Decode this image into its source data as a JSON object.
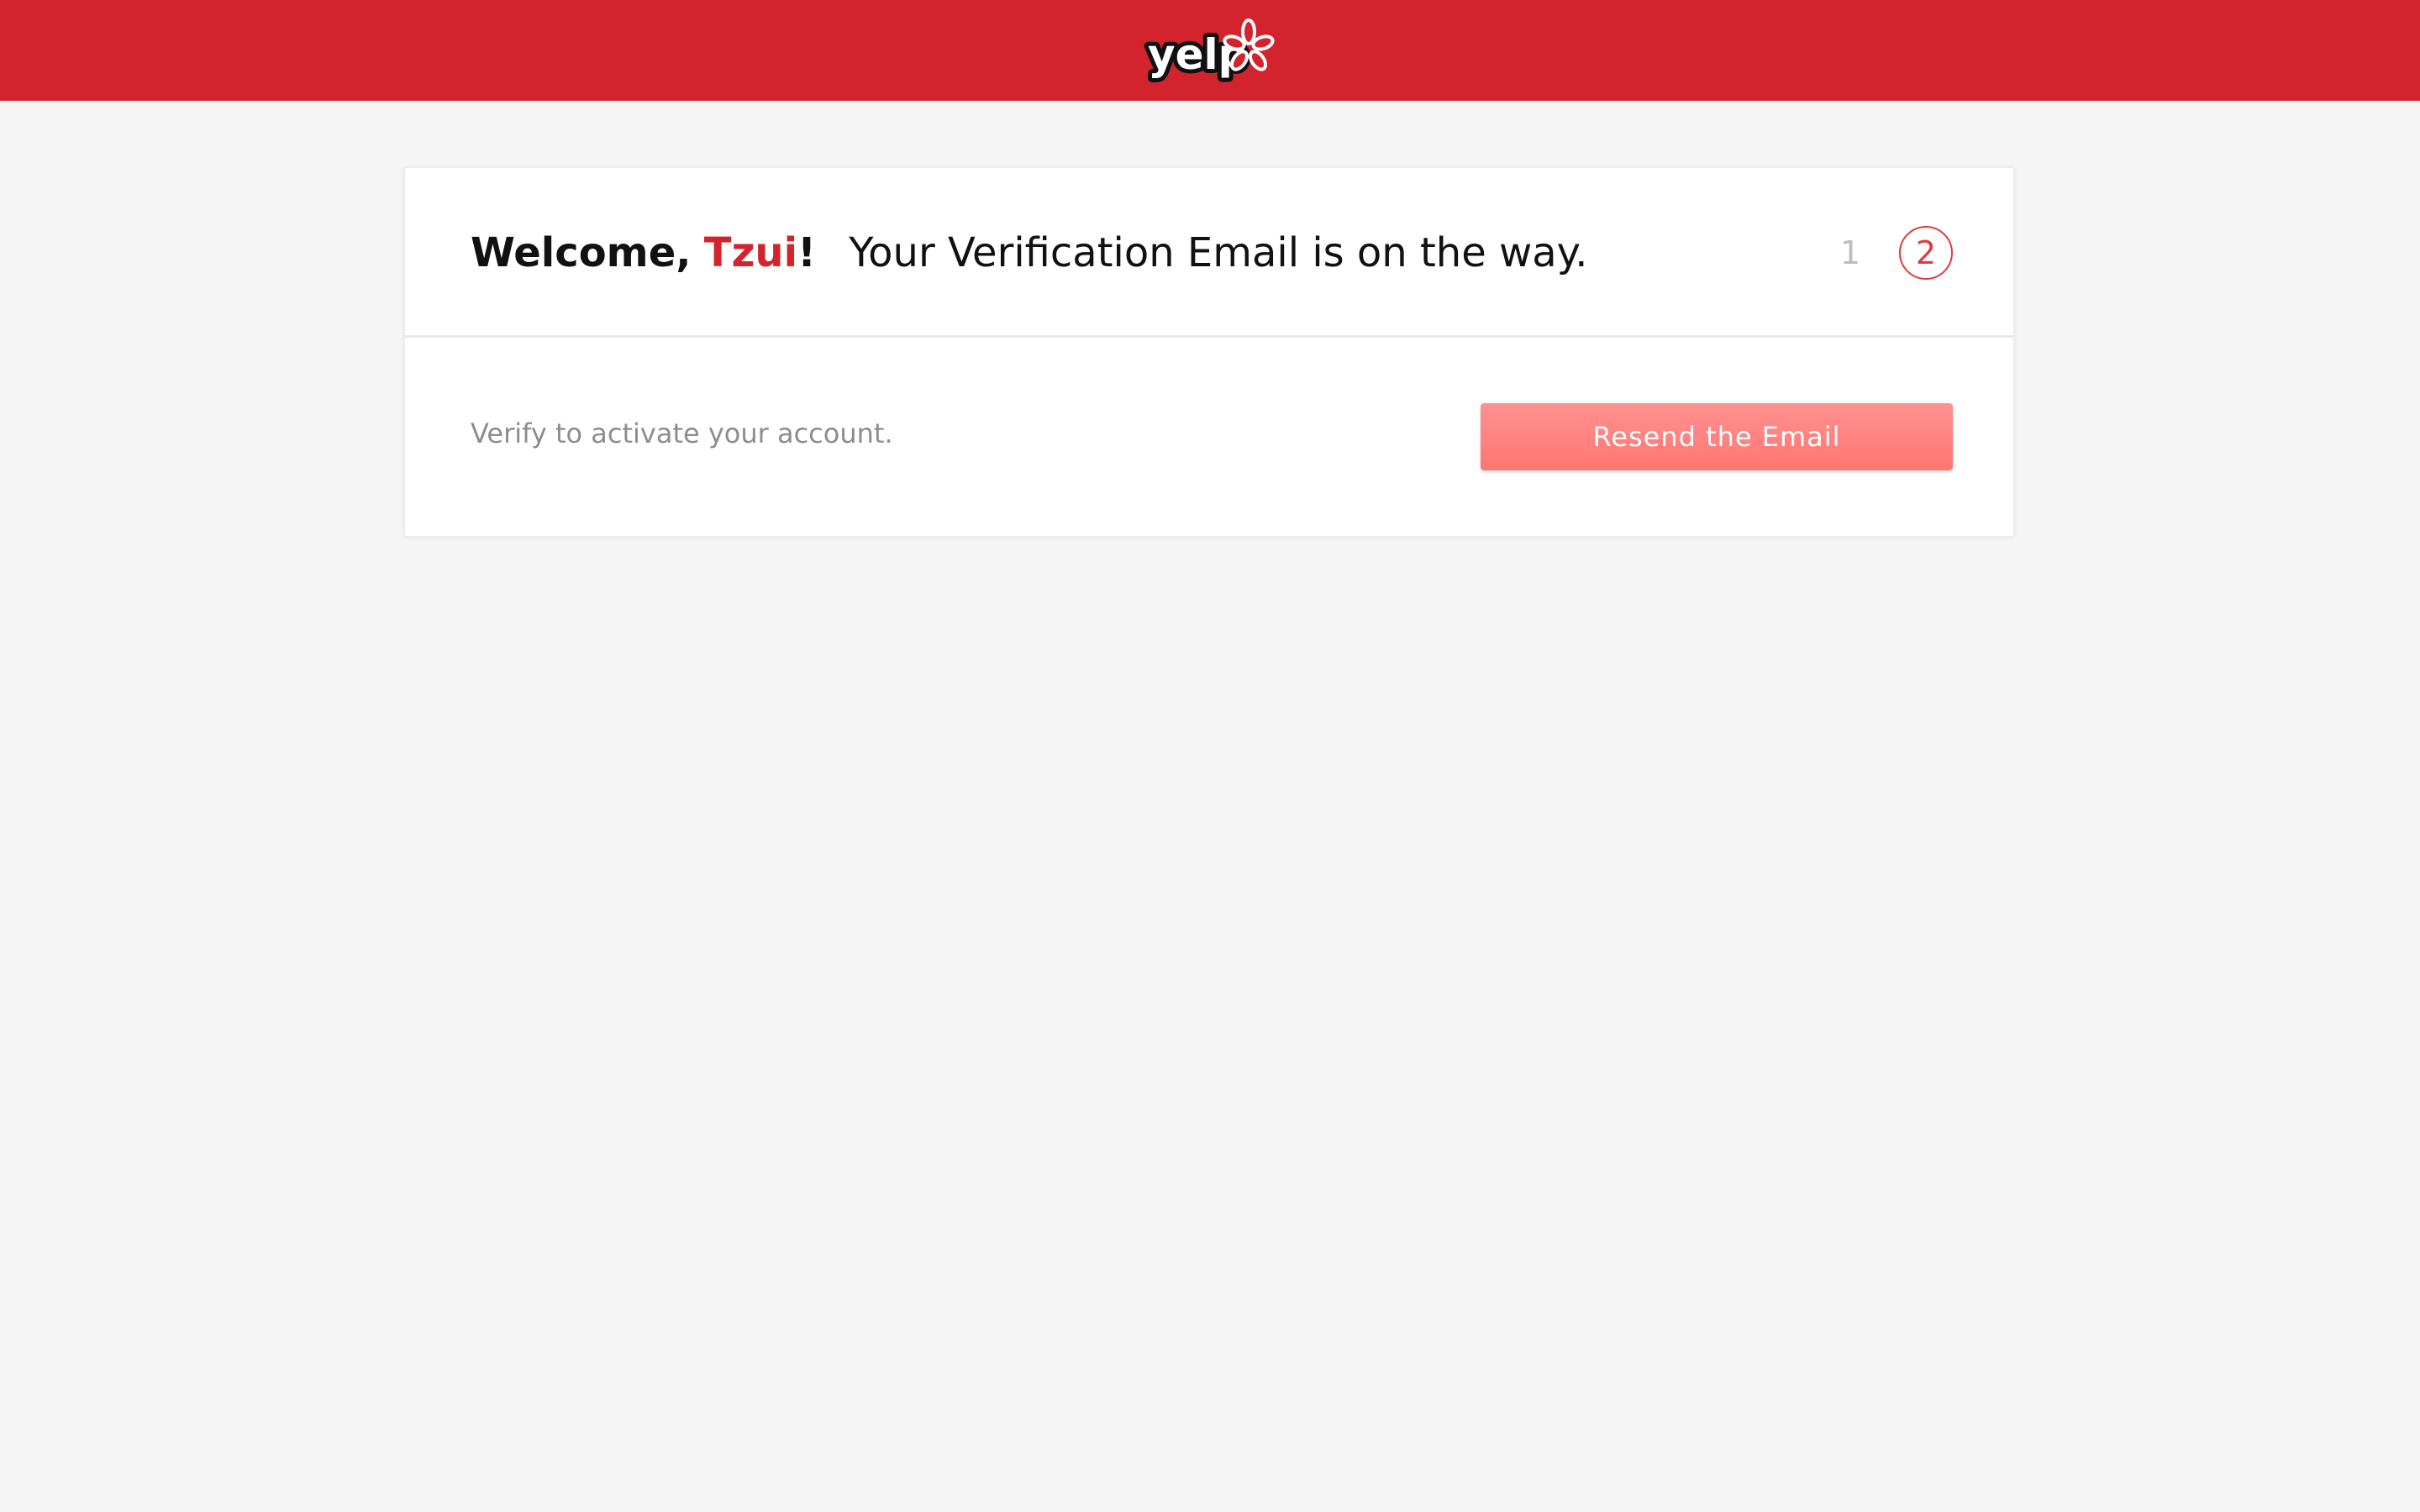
{
  "brand": {
    "logo_text": "yelp",
    "bar_color": "#d3242d",
    "accent_color": "#d3242d"
  },
  "card": {
    "welcome": "Welcome,",
    "user_name": "Tzui",
    "exclamation": "!",
    "message": "Your Verification Email is on the way.",
    "steps": [
      "1",
      "2"
    ],
    "active_step": 2,
    "subtext": "Verify to activate your account.",
    "button_label": "Resend the Email",
    "button_color": "#ff7f7c"
  }
}
